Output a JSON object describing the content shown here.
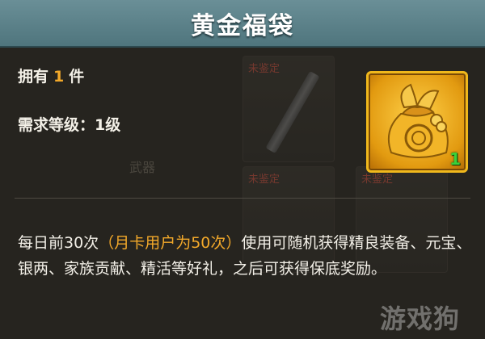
{
  "header": {
    "title": "黄金福袋"
  },
  "item": {
    "own_prefix": "拥有",
    "own_count": "1",
    "own_suffix": "件",
    "requirement": "需求等级：1级",
    "stack_count": "1",
    "icon": "golden-lucky-bag-icon"
  },
  "description": {
    "part1": "每日前30次",
    "highlight": "（月卡用户为50次）",
    "part2": "使用可随机获得精良装备、元宝、银两、家族贡献、精活等好礼，之后可获得保底奖励。"
  },
  "background": {
    "slot_tags": [
      "未鉴定",
      "未鉴定",
      "未鉴定"
    ],
    "ghost_label": "武器"
  },
  "watermark": "游戏狗",
  "colors": {
    "highlight": "#f3a92a",
    "count_green": "#3bd13a",
    "frame_gold": "#f0b81c",
    "title_bar": "#5f858d"
  }
}
